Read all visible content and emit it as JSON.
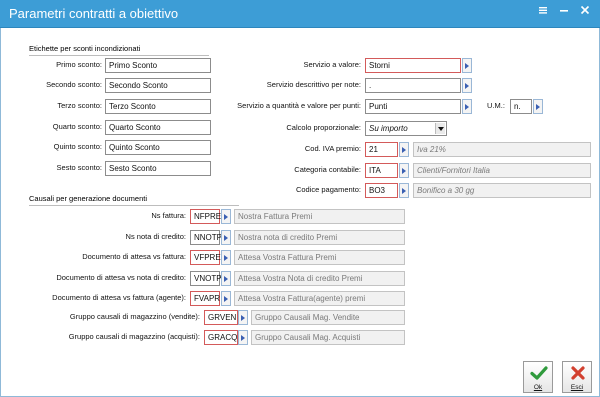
{
  "window": {
    "title": "Parametri contratti a obiettivo"
  },
  "titlebar_icons": [
    "menu-icon",
    "minimize-icon",
    "close-icon"
  ],
  "sections": {
    "etichette": "Etichette per sconti incondizionati",
    "causali": "Causali per generazione documenti"
  },
  "sconti": [
    {
      "label": "Primo sconto:",
      "value": "Primo Sconto"
    },
    {
      "label": "Secondo sconto:",
      "value": "Secondo Sconto"
    },
    {
      "label": "Terzo sconto:",
      "value": "Terzo Sconto"
    },
    {
      "label": "Quarto sconto:",
      "value": "Quarto Sconto"
    },
    {
      "label": "Quinto sconto:",
      "value": "Quinto Sconto"
    },
    {
      "label": "Sesto sconto:",
      "value": "Sesto Sconto"
    }
  ],
  "servizi": {
    "valore": {
      "label": "Servizio a valore:",
      "value": "Storni"
    },
    "note": {
      "label": "Servizio descrittivo per note:",
      "value": "."
    },
    "quantita": {
      "label": "Servizio a quantità e valore per punti:",
      "value": "Punti"
    },
    "um": {
      "label": "U.M.:",
      "value": "n."
    },
    "calcolo": {
      "label": "Calcolo proporzionale:",
      "value": "Su importo"
    },
    "iva": {
      "label": "Cod. IVA premio:",
      "value": "21",
      "desc": "Iva 21%"
    },
    "categoria": {
      "label": "Categoria contabile:",
      "value": "ITA",
      "desc": "Clienti/Fornitori Italia"
    },
    "pagamento": {
      "label": "Codice pagamento:",
      "value": "BO3",
      "desc": "Bonifico a 30 gg"
    }
  },
  "causali": [
    {
      "label": "Ns fattura:",
      "code": "NFPRE",
      "desc": "Nostra Fattura Premi"
    },
    {
      "label": "Ns nota di credito:",
      "code": "NNOTP",
      "desc": "Nostra nota di credito Premi"
    },
    {
      "label": "Documento di attesa vs fattura:",
      "code": "VFPRE",
      "desc": "Attesa Vostra Fattura Premi"
    },
    {
      "label": "Documento di attesa vs nota di credito:",
      "code": "VNOTP",
      "desc": "Attesa Vostra Nota di credito Premi"
    },
    {
      "label": "Documento di attesa vs fattura (agente):",
      "code": "FVAPR",
      "desc": "Attesa Vostra Fattura(agente) premi"
    }
  ],
  "magazzino": [
    {
      "label": "Gruppo causali di magazzino (vendite):",
      "code": "GRVEN",
      "desc": "Gruppo Causali Mag. Vendite"
    },
    {
      "label": "Gruppo causali di magazzino (acquisti):",
      "code": "GRACQ",
      "desc": "Gruppo Causali Mag. Acquisti"
    }
  ],
  "buttons": {
    "ok": "Ok",
    "esci": "Esci"
  },
  "colors": {
    "titlebar": "#3d9dd6",
    "required_border": "#d35a5a",
    "ok_icon": "#2f9a3c",
    "esci_icon": "#d2402f"
  }
}
